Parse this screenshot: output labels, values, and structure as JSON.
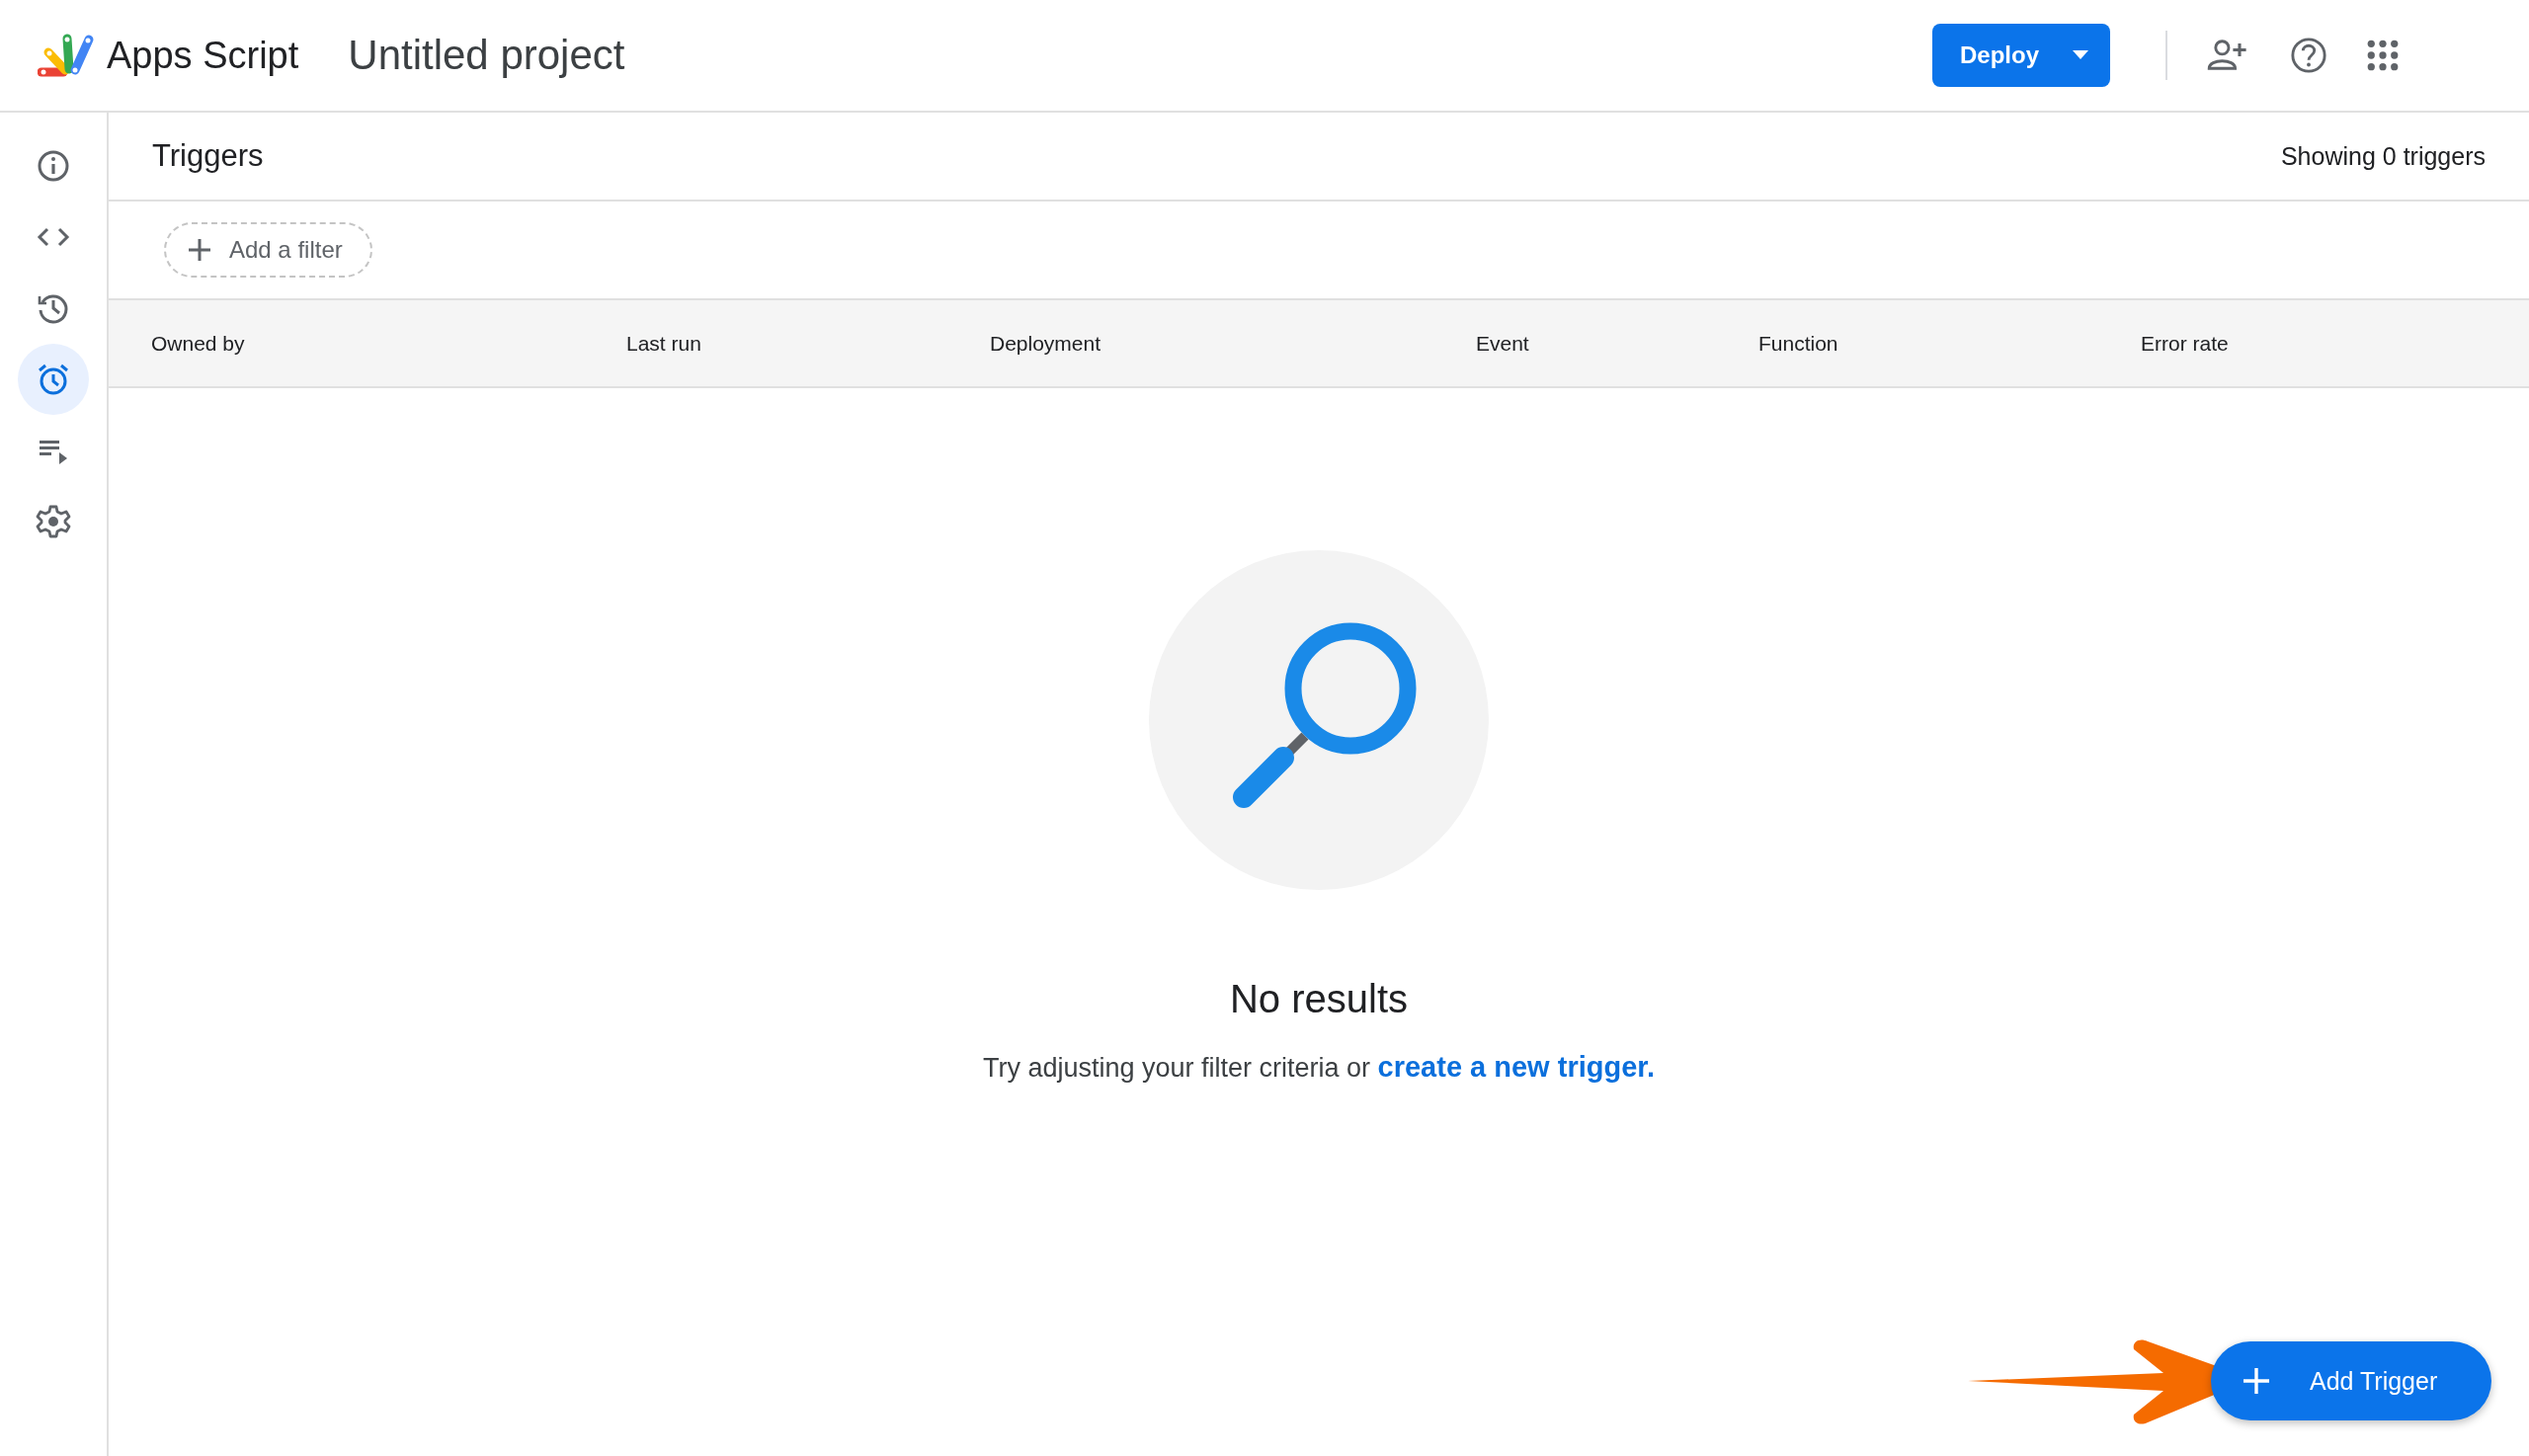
{
  "header": {
    "product": "Apps Script",
    "project_title": "Untitled project",
    "deploy_button": "Deploy"
  },
  "sidebar": {
    "items": [
      {
        "kind": "info",
        "selected": false
      },
      {
        "kind": "code",
        "selected": false
      },
      {
        "kind": "history",
        "selected": false
      },
      {
        "kind": "alarm",
        "selected": true
      },
      {
        "kind": "executions",
        "selected": false
      },
      {
        "kind": "settings",
        "selected": false
      }
    ]
  },
  "page": {
    "title": "Triggers",
    "count": "Showing 0 triggers"
  },
  "filter": {
    "label": "Add a filter"
  },
  "table": {
    "columns": [
      "Owned by",
      "Last run",
      "Deployment",
      "Event",
      "Function",
      "Error rate"
    ]
  },
  "empty_state": {
    "title": "No results",
    "text": "Try adjusting your filter criteria or",
    "link": "create a new trigger."
  },
  "fab": {
    "label": "Add Trigger"
  }
}
